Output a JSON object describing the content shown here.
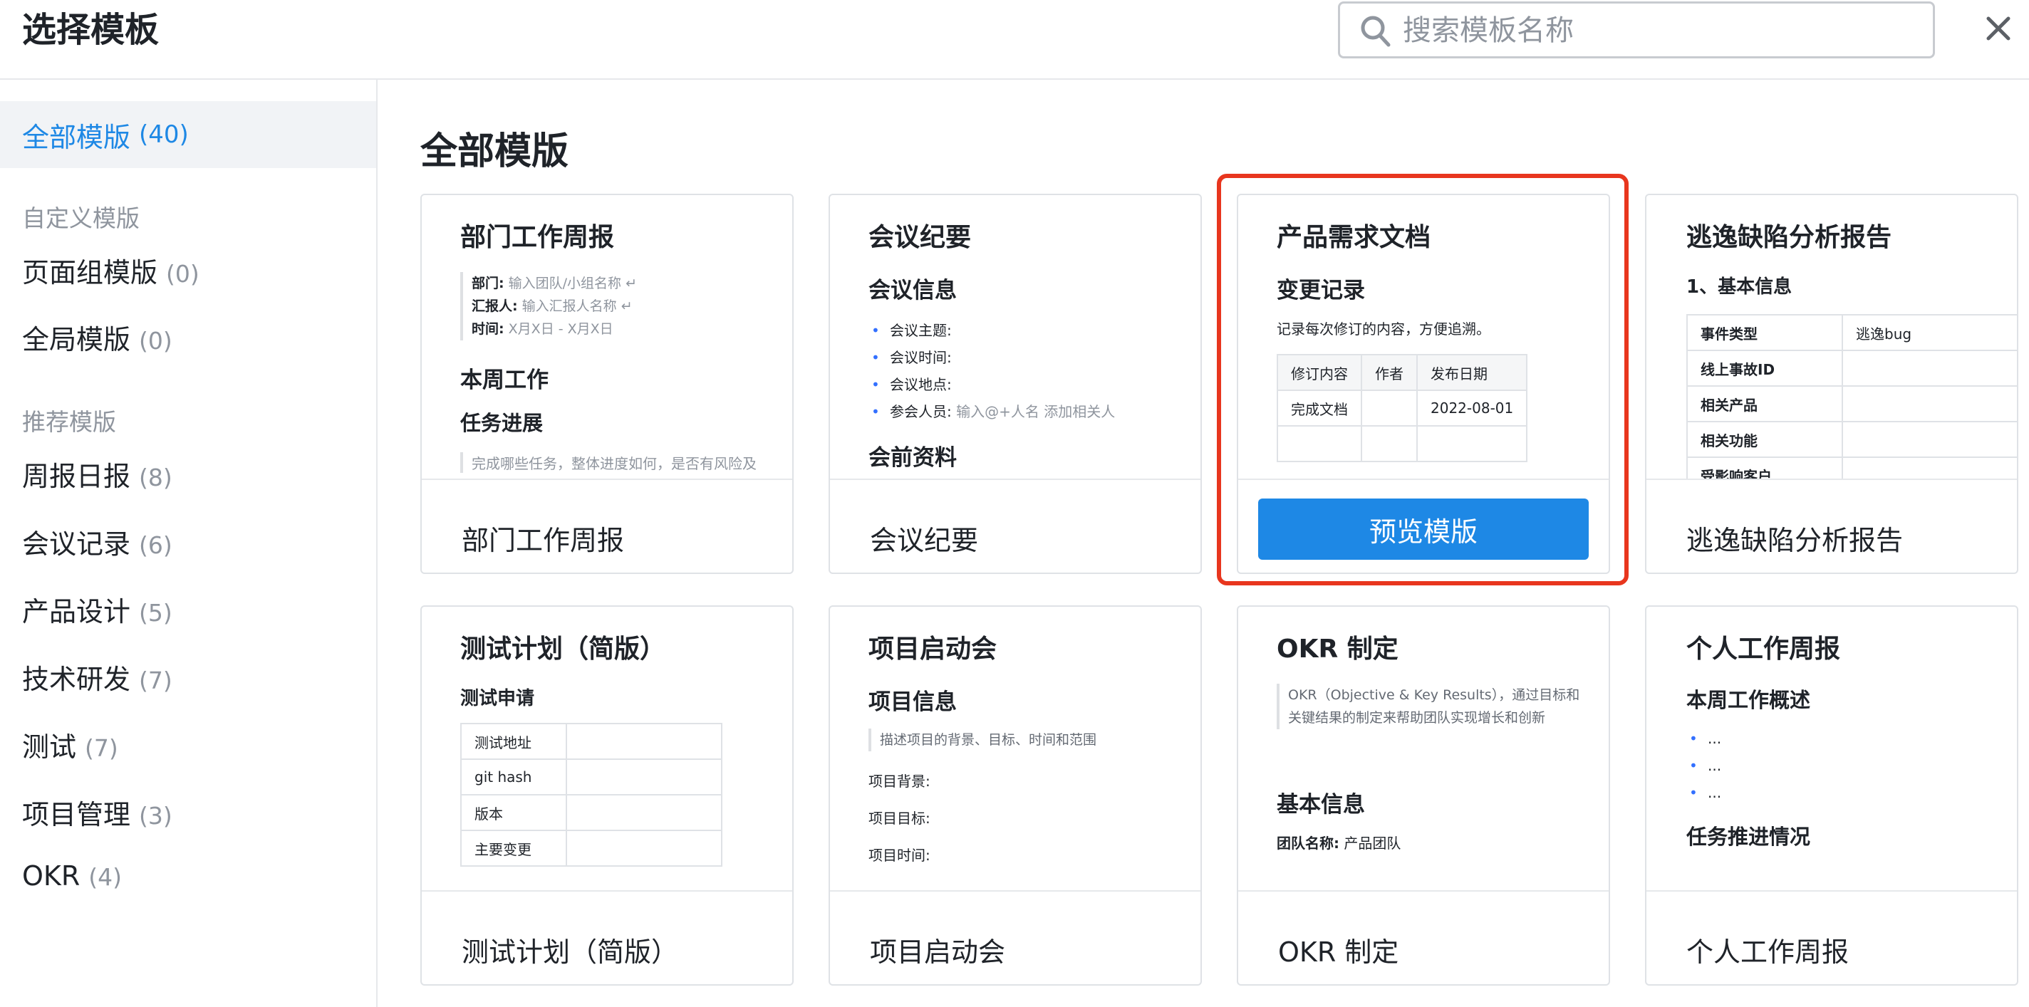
{
  "header": {
    "title": "选择模板",
    "search_placeholder": "搜索模板名称"
  },
  "sidebar": {
    "active": {
      "label": "全部模版",
      "count": "(40)"
    },
    "custom_title": "自定义模版",
    "custom_items": [
      {
        "label": "页面组模版",
        "count": "(0)"
      },
      {
        "label": "全局模版",
        "count": "(0)"
      }
    ],
    "recommend_title": "推荐模版",
    "recommend_items": [
      {
        "label": "周报日报",
        "count": "(8)"
      },
      {
        "label": "会议记录",
        "count": "(6)"
      },
      {
        "label": "产品设计",
        "count": "(5)"
      },
      {
        "label": "技术研发",
        "count": "(7)"
      },
      {
        "label": "测试",
        "count": "(7)"
      },
      {
        "label": "项目管理",
        "count": "(3)"
      },
      {
        "label": "OKR",
        "count": "(4)"
      }
    ]
  },
  "main": {
    "title": "全部模版",
    "preview_button": "预览模版",
    "cards": [
      {
        "name": "部门工作周报",
        "preview": {
          "title": "部门工作周报",
          "fields": [
            {
              "label": "部门:",
              "value": "输入团队/小组名称 ↵"
            },
            {
              "label": "汇报人:",
              "value": "输入汇报人名称 ↵"
            },
            {
              "label": "时间:",
              "value": "X月X日 - X月X日"
            }
          ],
          "h2": "本周工作",
          "h3": "任务进展",
          "faded": "完成哪些任务，整体进度如何，是否有风险及"
        }
      },
      {
        "name": "会议纪要",
        "preview": {
          "title": "会议纪要",
          "h2": "会议信息",
          "bullets": [
            {
              "label": "会议主题:",
              "hint": ""
            },
            {
              "label": "会议时间:",
              "hint": ""
            },
            {
              "label": "会议地点:",
              "hint": ""
            },
            {
              "label": "参会人员:",
              "hint": "输入@+人名 添加相关人"
            }
          ],
          "h2b": "会前资料"
        }
      },
      {
        "name": "产品需求文档",
        "preview": {
          "title": "产品需求文档",
          "h2": "变更记录",
          "text": "记录每次修订的内容，方便追溯。",
          "table_head": [
            "修订内容",
            "作者",
            "发布日期"
          ],
          "table_row": [
            "完成文档",
            "",
            "2022-08-01"
          ]
        }
      },
      {
        "name": "逃逸缺陷分析报告",
        "preview": {
          "title": "逃逸缺陷分析报告",
          "h3": "1、基本信息",
          "rows": [
            [
              "事件类型",
              "逃逸bug"
            ],
            [
              "线上事故ID",
              ""
            ],
            [
              "相关产品",
              ""
            ],
            [
              "相关功能",
              ""
            ],
            [
              "受影响客户",
              ""
            ]
          ]
        }
      },
      {
        "name": "测试计划（简版）",
        "preview": {
          "title": "测试计划（简版）",
          "h3": "测试申请",
          "rows": [
            "测试地址",
            "git hash",
            "版本",
            "主要变更"
          ]
        }
      },
      {
        "name": "项目启动会",
        "preview": {
          "title": "项目启动会",
          "h2": "项目信息",
          "quote": "描述项目的背景、目标、时间和范围",
          "lines": [
            "项目背景:",
            "项目目标:",
            "项目时间:"
          ]
        }
      },
      {
        "name": "OKR 制定",
        "preview": {
          "title": "OKR 制定",
          "quote": "OKR（Objective & Key Results），通过目标和关键结果的制定来帮助团队实现增长和创新",
          "h2": "基本信息",
          "field_label": "团队名称:",
          "field_value": "产品团队"
        }
      },
      {
        "name": "个人工作周报",
        "preview": {
          "title": "个人工作周报",
          "h3": "本周工作概述",
          "bullets": [
            "...",
            "...",
            "..."
          ],
          "h3b": "任务推进情况"
        }
      }
    ]
  }
}
